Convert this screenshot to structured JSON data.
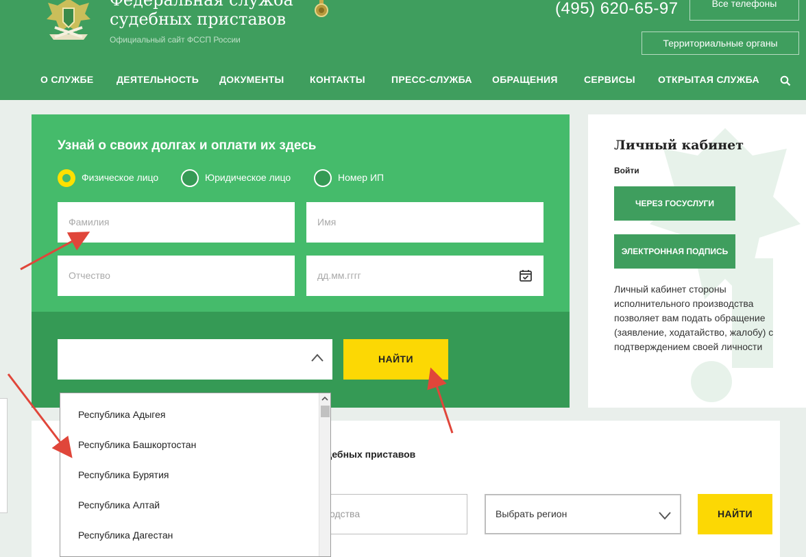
{
  "header": {
    "org_title_line1": "Федеральная служба",
    "org_title_line2": "судебных приставов",
    "subtitle": "Официальный сайт ФССП России",
    "phone": "(495) 620-65-97",
    "all_phones_label": "Все телефоны",
    "territorial_label": "Территориальные органы",
    "nav": [
      "О СЛУЖБЕ",
      "ДЕЯТЕЛЬНОСТЬ",
      "ДОКУМЕНТЫ",
      "КОНТАКТЫ",
      "ПРЕСС-СЛУЖБА",
      "ОБРАЩЕНИЯ",
      "СЕРВИСЫ",
      "ОТКРЫТАЯ СЛУЖБА"
    ],
    "search_icon": "search-icon"
  },
  "search_form": {
    "title": "Узнай о своих долгах и оплати их здесь",
    "radios": [
      {
        "label": "Физическое лицо",
        "selected": true
      },
      {
        "label": "Юридическое лицо",
        "selected": false
      },
      {
        "label": "Номер ИП",
        "selected": false
      }
    ],
    "placeholders": {
      "surname": "Фамилия",
      "name": "Имя",
      "patronymic": "Отчество",
      "birthdate": "дд.мм.гггг"
    },
    "region_select_value": "",
    "find_label": "НАЙТИ"
  },
  "region_dropdown": {
    "options": [
      "Республика Адыгея",
      "Республика Башкортостан",
      "Республика Бурятия",
      "Республика Алтай",
      "Республика Дагестан"
    ]
  },
  "cabinet": {
    "title": "Личный кабинет",
    "login_label": "Войти",
    "gosuslugi_label": "ЧЕРЕЗ ГОСУСЛУГИ",
    "signature_label": "ЭЛЕКТРОННАЯ ПОДПИСЬ",
    "description": "Личный кабинет стороны исполнительного производства позволяет вам подать обращение (заявление, ходатайство, жалобу) с подтверждением своей личности"
  },
  "lower_section": {
    "title_fragment": "удебных приставов",
    "input_placeholder_fragment": "одства",
    "region_select_value": "Выбрать регион",
    "find_label": "НАЙТИ"
  },
  "colors": {
    "header_green": "#3f9e5e",
    "form_green": "#45bb6b",
    "form_dark_green": "#359a55",
    "button_yellow": "#fcd804",
    "annotation_red": "#e0463a"
  }
}
